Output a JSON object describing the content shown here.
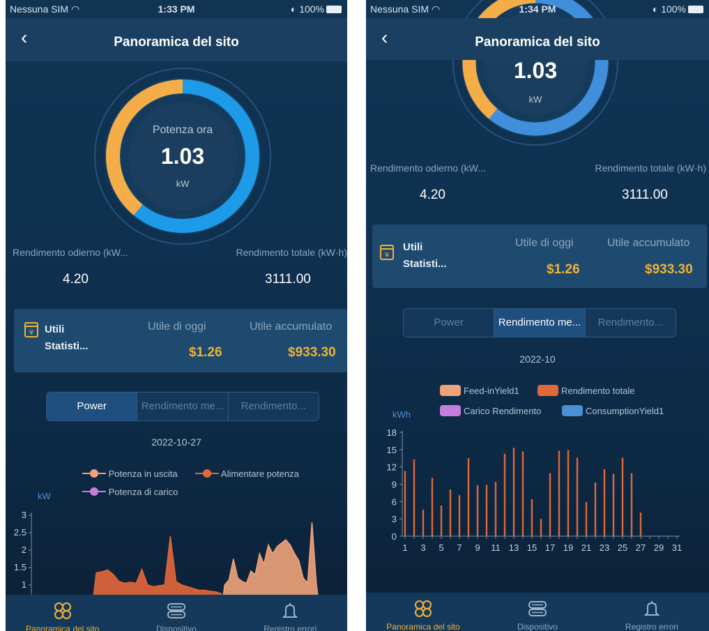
{
  "left": {
    "status": {
      "carrier": "Nessuna SIM",
      "time": "1:33 PM",
      "battery": "100%"
    },
    "title": "Panoramica del sito",
    "gauge": {
      "label": "Potenza ora",
      "value": "1.03",
      "unit": "kW",
      "yellow_fraction": 0.39
    },
    "daily_yield_label": "Rendimento odierno (kW...",
    "daily_yield_value": "4.20",
    "total_yield_label": "Rendimento totale (kW·h)",
    "total_yield_value": "3111.00",
    "card": {
      "title1": "Utili",
      "title2": "Statisti...",
      "today_label": "Utile di oggi",
      "today_value": "$1.26",
      "acc_label": "Utile accumulato",
      "acc_value": "$933.30"
    },
    "tabs": [
      "Power",
      "Rendimento me...",
      "Rendimento..."
    ],
    "active_tab": 0,
    "date": "2022-10-27",
    "tabbar": [
      "Panoramica del sito",
      "Dispositivo",
      "Registro errori"
    ]
  },
  "right": {
    "status": {
      "carrier": "Nessuna SIM",
      "time": "1:34 PM",
      "battery": "100%"
    },
    "title": "Panoramica del sito",
    "gauge": {
      "value": "1.03",
      "unit": "kW",
      "yellow_fraction": 0.39
    },
    "daily_yield_label": "Rendimento odierno (kW...",
    "daily_yield_value": "4.20",
    "total_yield_label": "Rendimento totale (kW·h)",
    "total_yield_value": "3111.00",
    "card": {
      "title1": "Utili",
      "title2": "Statisti...",
      "today_label": "Utile di oggi",
      "today_value": "$1.26",
      "acc_label": "Utile accumulato",
      "acc_value": "$933.30"
    },
    "tabs": [
      "Power",
      "Rendimento me...",
      "Rendimento..."
    ],
    "active_tab": 1,
    "date": "2022-10",
    "tabbar": [
      "Panoramica del sito",
      "Dispositivo",
      "Registro errori"
    ]
  },
  "chart_data": [
    {
      "type": "area",
      "ylabel": "kW",
      "ylim": [
        0,
        3
      ],
      "yticks": [
        "1",
        "1.5",
        "2",
        "2.5",
        "3"
      ],
      "legend": [
        "Potenza in uscita",
        "Alimentare potenza",
        "Potenza di carico"
      ],
      "colors": {
        "Potenza in uscita": "#f0a37a",
        "Alimentare potenza": "#e2673a",
        "Potenza di carico": "#c77ddb"
      },
      "series": [
        {
          "name": "Alimentare potenza",
          "values": [
            0,
            1.35,
            1.38,
            1.43,
            1.3,
            1.1,
            1.05,
            1.08,
            1.05,
            1.45,
            1.0,
            0.95,
            0.98,
            1.0,
            2.4,
            1.1,
            1.0,
            0.95,
            0.9,
            0.85,
            0.85,
            0.82,
            0.8,
            0.75,
            0
          ]
        },
        {
          "name": "Potenza in uscita",
          "values": [
            0,
            1.0,
            1.15,
            1.75,
            1.2,
            1.1,
            1.05,
            1.4,
            1.3,
            1.9,
            1.6,
            2.15,
            1.9,
            2.1,
            2.2,
            2.3,
            2.15,
            1.9,
            1.7,
            1.2,
            1.05,
            2.8,
            1.05,
            0
          ]
        }
      ]
    },
    {
      "type": "bar",
      "ylabel": "kWh",
      "ylim": [
        0,
        18
      ],
      "yticks": [
        0,
        3,
        6,
        9,
        12,
        15,
        18
      ],
      "xticks": [
        "1",
        "3",
        "5",
        "7",
        "9",
        "11",
        "13",
        "15",
        "17",
        "19",
        "21",
        "23",
        "25",
        "27",
        "29",
        "31"
      ],
      "legend": [
        "Feed-inYield1",
        "Rendimento totale",
        "Carico Rendimento",
        "ConsumptionYield1"
      ],
      "colors": {
        "Feed-inYield1": "#f0a37a",
        "Rendimento totale": "#e2673a",
        "Carico Rendimento": "#c77ddb",
        "ConsumptionYield1": "#4a90d9"
      },
      "series": [
        {
          "name": "Rendimento totale",
          "values": [
            11.3,
            13.3,
            4.6,
            10.1,
            5.3,
            8.1,
            7.1,
            13.5,
            8.8,
            8.9,
            9.4,
            14.3,
            15.3,
            14.7,
            6.4,
            3.0,
            10.9,
            14.8,
            14.9,
            13.6,
            5.9,
            9.3,
            11.6,
            10.8,
            13.6,
            10.9,
            4.1,
            0,
            0,
            0,
            0
          ]
        }
      ]
    }
  ]
}
